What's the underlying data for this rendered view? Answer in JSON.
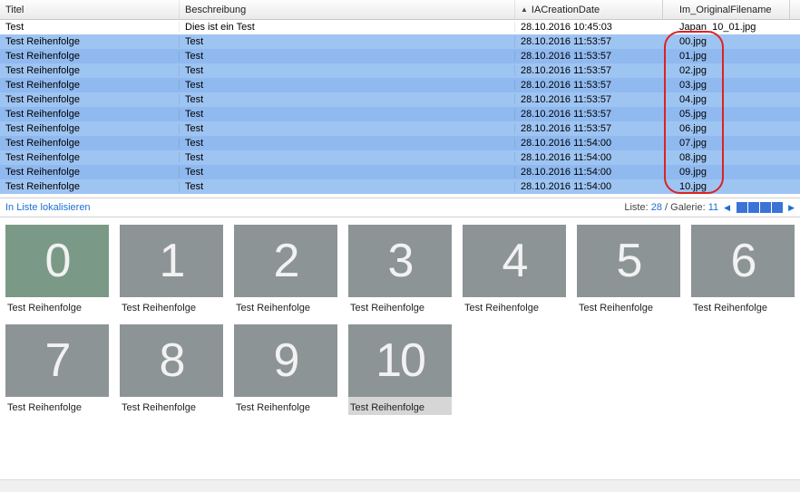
{
  "columns": {
    "title": "Titel",
    "desc": "Beschreibung",
    "date": "IACreationDate",
    "file": "Im_OriginalFilename"
  },
  "rows": [
    {
      "selected": false,
      "title": "Test",
      "desc": "Dies ist ein Test",
      "date": "28.10.2016 10:45:03",
      "file": "Japan_10_01.jpg"
    },
    {
      "selected": true,
      "title": "Test Reihenfolge",
      "desc": "Test",
      "date": "28.10.2016 11:53:57",
      "file": "00.jpg"
    },
    {
      "selected": true,
      "title": "Test Reihenfolge",
      "desc": "Test",
      "date": "28.10.2016 11:53:57",
      "file": "01.jpg"
    },
    {
      "selected": true,
      "title": "Test Reihenfolge",
      "desc": "Test",
      "date": "28.10.2016 11:53:57",
      "file": "02.jpg"
    },
    {
      "selected": true,
      "title": "Test Reihenfolge",
      "desc": "Test",
      "date": "28.10.2016 11:53:57",
      "file": "03.jpg"
    },
    {
      "selected": true,
      "title": "Test Reihenfolge",
      "desc": "Test",
      "date": "28.10.2016 11:53:57",
      "file": "04.jpg"
    },
    {
      "selected": true,
      "title": "Test Reihenfolge",
      "desc": "Test",
      "date": "28.10.2016 11:53:57",
      "file": "05.jpg"
    },
    {
      "selected": true,
      "title": "Test Reihenfolge",
      "desc": "Test",
      "date": "28.10.2016 11:53:57",
      "file": "06.jpg"
    },
    {
      "selected": true,
      "title": "Test Reihenfolge",
      "desc": "Test",
      "date": "28.10.2016 11:54:00",
      "file": "07.jpg"
    },
    {
      "selected": true,
      "title": "Test Reihenfolge",
      "desc": "Test",
      "date": "28.10.2016 11:54:00",
      "file": "08.jpg"
    },
    {
      "selected": true,
      "title": "Test Reihenfolge",
      "desc": "Test",
      "date": "28.10.2016 11:54:00",
      "file": "09.jpg"
    },
    {
      "selected": true,
      "title": "Test Reihenfolge",
      "desc": "Test",
      "date": "28.10.2016 11:54:00",
      "file": "10.jpg"
    }
  ],
  "status": {
    "localize": "In Liste lokalisieren",
    "list_label": "Liste:",
    "list_count": "28",
    "gallery_label": "Galerie:",
    "gallery_count": "11",
    "chevron_left": "◀",
    "chevron_right": "▶"
  },
  "gallery": [
    {
      "glyph": "0",
      "caption": "Test Reihenfolge",
      "green": true,
      "selected": false
    },
    {
      "glyph": "1",
      "caption": "Test Reihenfolge",
      "green": false,
      "selected": false
    },
    {
      "glyph": "2",
      "caption": "Test Reihenfolge",
      "green": false,
      "selected": false
    },
    {
      "glyph": "3",
      "caption": "Test Reihenfolge",
      "green": false,
      "selected": false
    },
    {
      "glyph": "4",
      "caption": "Test Reihenfolge",
      "green": false,
      "selected": false
    },
    {
      "glyph": "5",
      "caption": "Test Reihenfolge",
      "green": false,
      "selected": false
    },
    {
      "glyph": "6",
      "caption": "Test Reihenfolge",
      "green": false,
      "selected": false
    },
    {
      "glyph": "7",
      "caption": "Test Reihenfolge",
      "green": false,
      "selected": false
    },
    {
      "glyph": "8",
      "caption": "Test Reihenfolge",
      "green": false,
      "selected": false
    },
    {
      "glyph": "9",
      "caption": "Test Reihenfolge",
      "green": false,
      "selected": false
    },
    {
      "glyph": "10",
      "caption": "Test Reihenfolge",
      "green": false,
      "selected": true
    }
  ],
  "sort_indicator": "▲"
}
